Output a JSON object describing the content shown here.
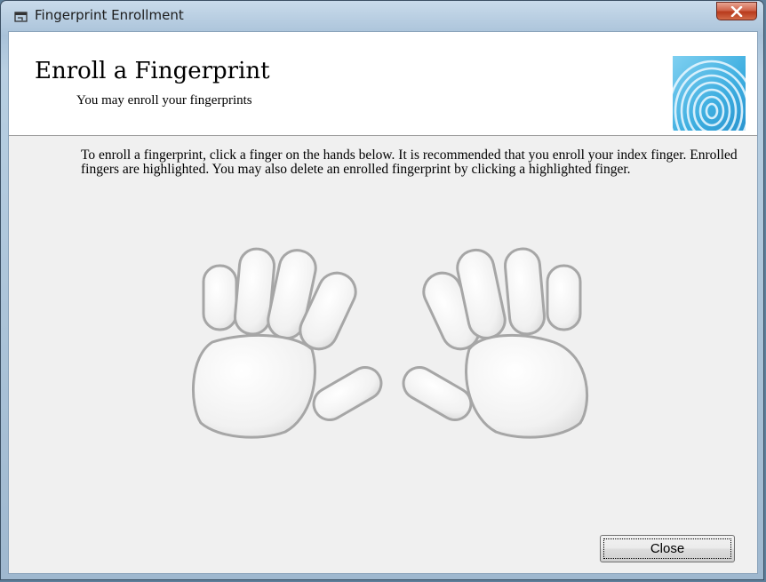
{
  "window": {
    "title": "Fingerprint Enrollment",
    "icon": "app-window-icon",
    "close_icon": "close-x-icon"
  },
  "header": {
    "title": "Enroll a Fingerprint",
    "subtitle": "You may enroll your fingerprints",
    "logo_icon": "fingerprint-icon"
  },
  "instructions": "To enroll a fingerprint, click a finger on the hands below. It is recommended that you enroll your index finger. Enrolled fingers are highlighted. You may also delete an enrolled fingerprint by clicking a highlighted finger.",
  "hands": {
    "left": [
      "left-little",
      "left-ring",
      "left-middle",
      "left-index",
      "left-thumb"
    ],
    "right": [
      "right-thumb",
      "right-index",
      "right-middle",
      "right-ring",
      "right-little"
    ],
    "enrolled": []
  },
  "buttons": {
    "close_label": "Close"
  },
  "colors": {
    "finger_fill": "#f4f4f4",
    "finger_stroke": "#a8a8a8",
    "header_bg": "#ffffff",
    "client_bg": "#f0f0f0"
  }
}
